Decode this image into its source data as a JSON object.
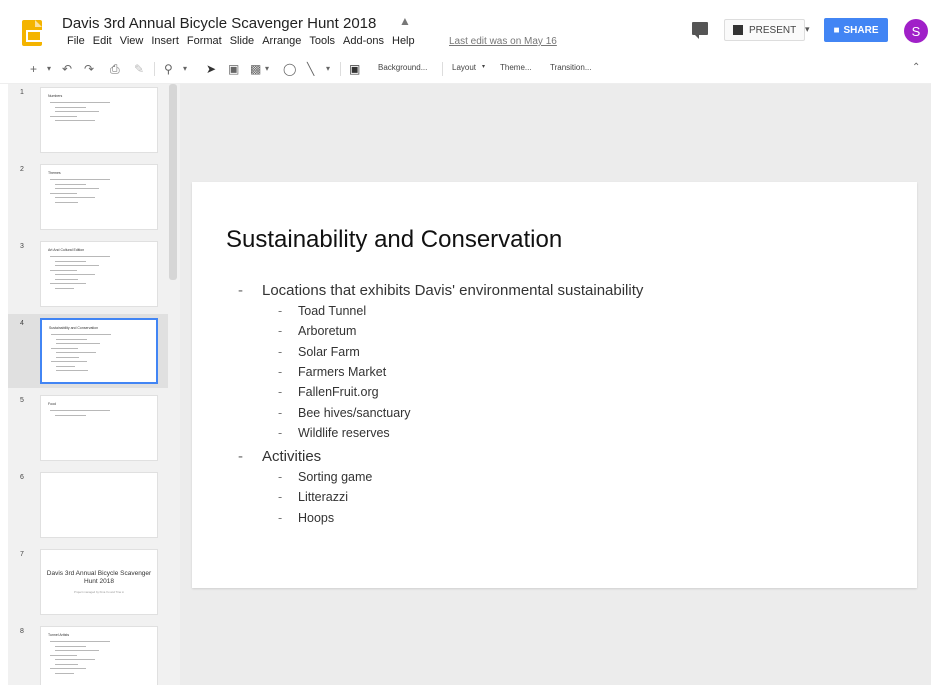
{
  "header": {
    "title": "Davis 3rd Annual Bicycle Scavenger Hunt 2018",
    "last_edit": "Last edit was on May 16",
    "present_label": "PRESENT",
    "share_label": "SHARE",
    "avatar_initial": "S"
  },
  "menu": [
    "File",
    "Edit",
    "View",
    "Insert",
    "Format",
    "Slide",
    "Arrange",
    "Tools",
    "Add-ons",
    "Help"
  ],
  "toolbar": {
    "background_label": "Background...",
    "layout_label": "Layout",
    "theme_label": "Theme...",
    "transition_label": "Transition..."
  },
  "filmstrip": {
    "slides": [
      {
        "number": "1",
        "title": "Numbers",
        "lines": 5
      },
      {
        "number": "2",
        "title": "Themes",
        "lines": 6
      },
      {
        "number": "3",
        "title": "Art And Cultural Edition",
        "lines": 8
      },
      {
        "number": "4",
        "title": "Sustainability and Conservation",
        "lines": 9
      },
      {
        "number": "5",
        "title": "Food",
        "lines": 2
      },
      {
        "number": "6",
        "title": "",
        "lines": 0
      },
      {
        "number": "7",
        "title": "Davis 3rd Annual Bicycle Scavenger Hunt 2018",
        "subtitle": "Project managed by Kina Xu and Tina Li"
      },
      {
        "number": "8",
        "title": "Tunnel Artists",
        "lines": 8
      }
    ],
    "selected_index": 3
  },
  "slide": {
    "title": "Sustainability and Conservation",
    "sections": [
      {
        "text": "Locations that exhibits Davis' environmental sustainability",
        "items": [
          "Toad Tunnel",
          "Arboretum",
          "Solar Farm",
          "Farmers Market",
          "FallenFruit.org",
          "Bee hives/sanctuary",
          "Wildlife reserves"
        ]
      },
      {
        "text": "Activities",
        "items": [
          "Sorting game",
          "Litterazzi",
          "Hoops"
        ]
      }
    ],
    "bullet_marker": "-"
  },
  "colors": {
    "accent": "#4285f4",
    "app_icon": "#f4b400",
    "avatar": "#a020c8"
  }
}
